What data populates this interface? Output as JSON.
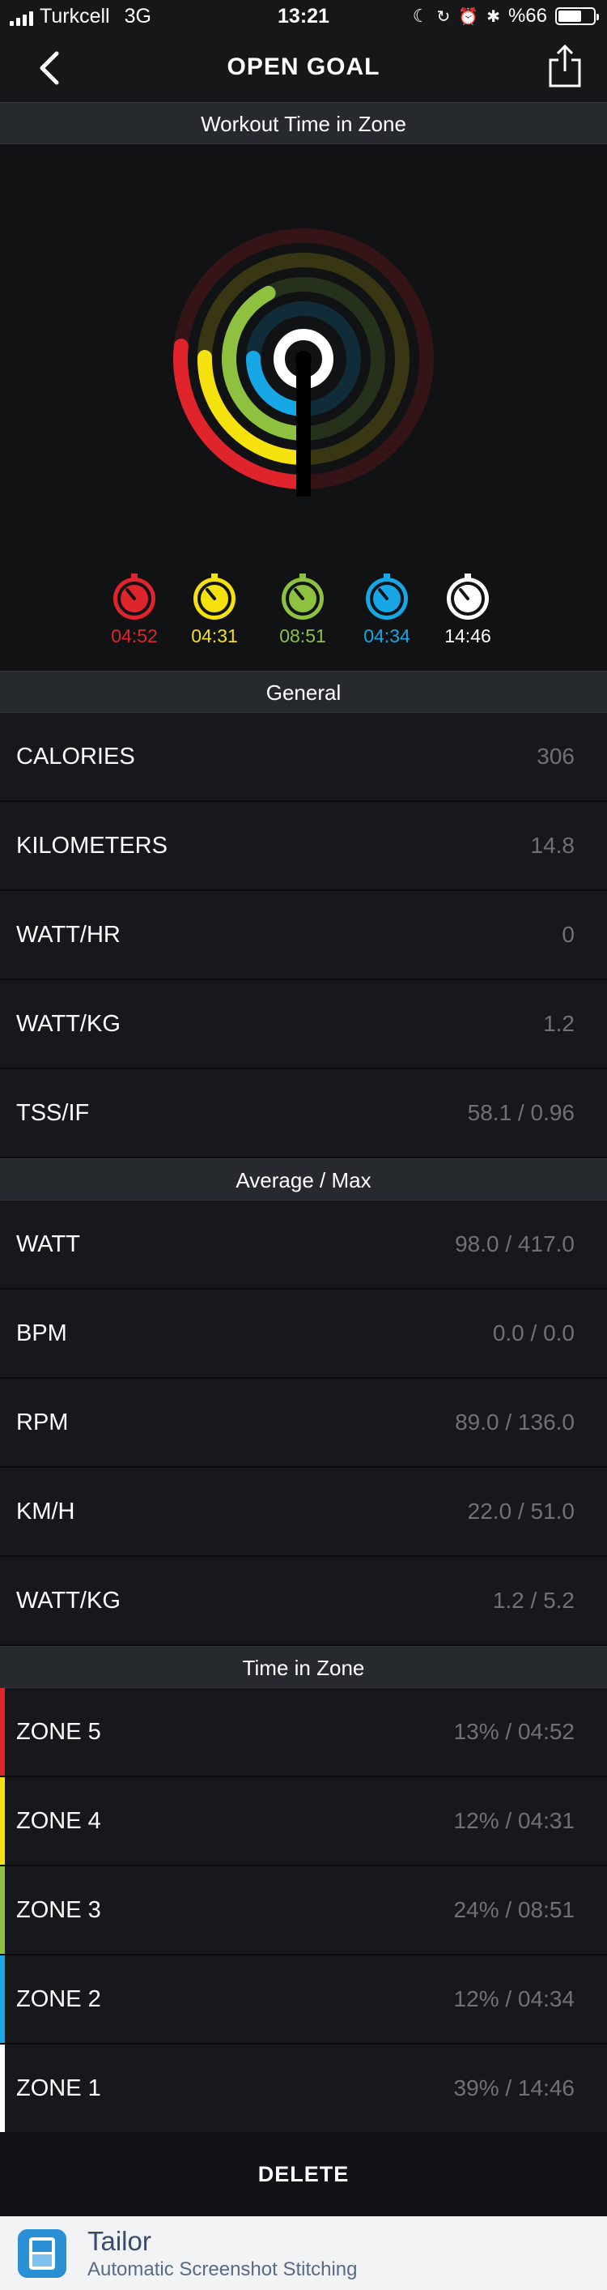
{
  "status": {
    "carrier": "Turkcell",
    "network": "3G",
    "time": "13:21",
    "battery": "%66",
    "battery_level": 0.66
  },
  "nav": {
    "title": "OPEN GOAL",
    "back_icon": "chevron-left-icon",
    "share_icon": "share-icon"
  },
  "chart_header": "Workout Time in Zone",
  "zones_summary": [
    {
      "time": "04:52",
      "color": "#e0242b",
      "fraction": 0.13
    },
    {
      "time": "04:31",
      "color": "#f5e10e",
      "fraction": 0.12
    },
    {
      "time": "08:51",
      "color": "#8dc13f",
      "fraction": 0.24
    },
    {
      "time": "04:34",
      "color": "#18a7e6",
      "fraction": 0.12
    },
    {
      "time": "14:46",
      "color": "#ffffff",
      "fraction": 0.39
    }
  ],
  "general": {
    "header": "General",
    "rows": [
      {
        "label": "CALORIES",
        "value": "306"
      },
      {
        "label": "KILOMETERS",
        "value": "14.8"
      },
      {
        "label": "WATT/HR",
        "value": "0"
      },
      {
        "label": "WATT/KG",
        "value": "1.2"
      },
      {
        "label": "TSS/IF",
        "value": "58.1 / 0.96"
      }
    ]
  },
  "average_max": {
    "header": "Average / Max",
    "rows": [
      {
        "label": "WATT",
        "value": "98.0 / 417.0"
      },
      {
        "label": "BPM",
        "value": "0.0 / 0.0"
      },
      {
        "label": "RPM",
        "value": "89.0 / 136.0"
      },
      {
        "label": "KM/H",
        "value": "22.0 / 51.0"
      },
      {
        "label": "WATT/KG",
        "value": "1.2 / 5.2"
      }
    ]
  },
  "time_in_zone": {
    "header": "Time in Zone",
    "rows": [
      {
        "label": "ZONE 5",
        "value": "13% / 04:52",
        "color": "#e0242b"
      },
      {
        "label": "ZONE 4",
        "value": "12% / 04:31",
        "color": "#f5e10e"
      },
      {
        "label": "ZONE 3",
        "value": "24% / 08:51",
        "color": "#8dc13f"
      },
      {
        "label": "ZONE 2",
        "value": "12% / 04:34",
        "color": "#18a7e6"
      },
      {
        "label": "ZONE 1",
        "value": "39% / 14:46",
        "color": "#ffffff"
      }
    ]
  },
  "delete_label": "DELETE",
  "tailor": {
    "title": "Tailor",
    "subtitle": "Automatic Screenshot Stitching"
  }
}
